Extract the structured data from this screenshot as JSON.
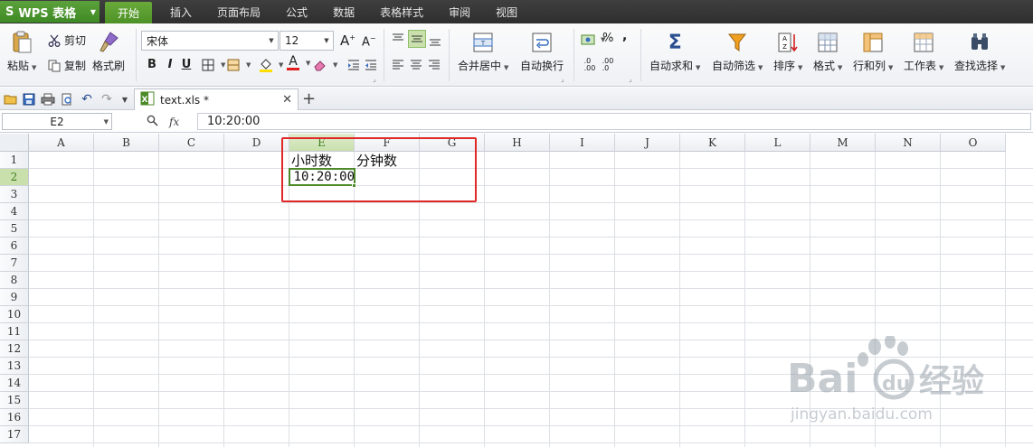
{
  "app": {
    "name": "WPS 表格",
    "logo": "S"
  },
  "menu_tabs": [
    "开始",
    "插入",
    "页面布局",
    "公式",
    "数据",
    "表格样式",
    "审阅",
    "视图"
  ],
  "active_tab": "开始",
  "ribbon": {
    "paste": "粘贴",
    "cut": "剪切",
    "copy": "复制",
    "format_painter": "格式刷",
    "font_name": "宋体",
    "font_size": "12",
    "bold": "B",
    "italic": "I",
    "underline": "U",
    "merge_center": "合并居中",
    "wrap_text": "自动换行",
    "percent": "%",
    "comma": ",",
    "auto_sum": "自动求和",
    "auto_filter": "自动筛选",
    "sort": "排序",
    "format": "格式",
    "rows_cols": "行和列",
    "worksheet": "工作表",
    "find_select": "查找选择"
  },
  "document_tab": {
    "name": "text.xls *"
  },
  "formula_bar": {
    "cell_ref": "E2",
    "fx": "fx",
    "value": "10:20:00"
  },
  "sheet": {
    "columns": [
      "A",
      "B",
      "C",
      "D",
      "E",
      "F",
      "G",
      "H",
      "I",
      "J",
      "K",
      "L",
      "M",
      "N",
      "O"
    ],
    "rows": [
      "1",
      "2",
      "3",
      "4",
      "5",
      "6",
      "7",
      "8",
      "9",
      "10",
      "11",
      "12",
      "13",
      "14",
      "15",
      "16",
      "17"
    ],
    "selected_column": "E",
    "selected_row": "2",
    "cells": {
      "E1": "小时数",
      "F1": "分钟数",
      "E2": "10:20:00"
    }
  },
  "watermark": {
    "brand": "Bai",
    "brand_cn": "经验",
    "url": "jingyan.baidu.com"
  },
  "colors": {
    "accent_green": "#4d8a2a",
    "highlight_red": "#e02828",
    "menu_bg": "#333333"
  }
}
